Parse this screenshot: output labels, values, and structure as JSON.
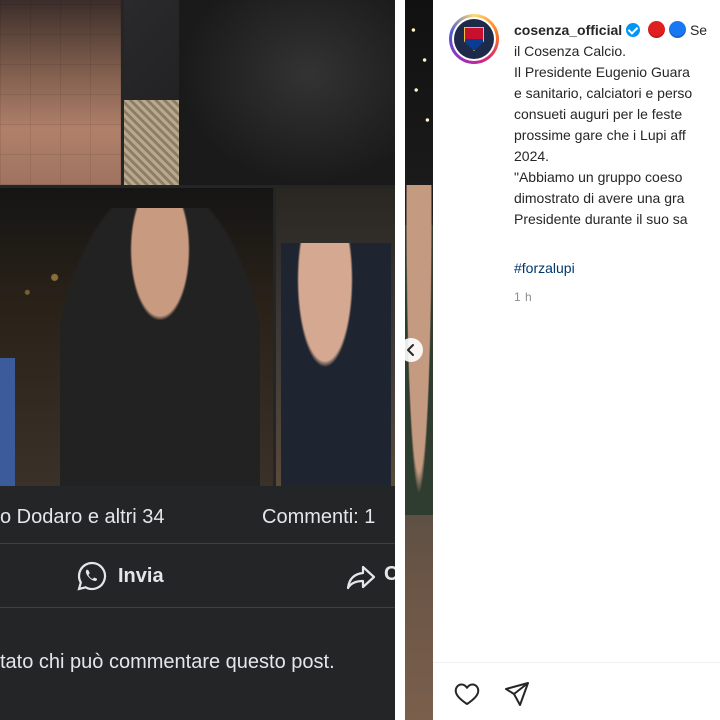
{
  "facebook_post": {
    "likes_text": "o Dodaro e altri 34",
    "comments_text": "Commenti: 1",
    "share_label": "Invia",
    "forward_label": "C",
    "restricted_text": "tato chi può commentare questo post."
  },
  "instagram_post": {
    "username": "cosenza_official",
    "caption_lines": [
      "Se",
      "il Cosenza Calcio.",
      "Il Presidente Eugenio Guara",
      "e sanitario, calciatori e perso",
      "consueti auguri per le feste",
      "prossime gare che i Lupi aff",
      "2024.",
      "\"Abbiamo un gruppo coeso",
      "dimostrato di avere una gra",
      "Presidente durante il suo sa"
    ],
    "hashtag": "#forzalupi",
    "time": "1 h",
    "icons": {
      "verified": "verified-badge-icon",
      "red_circle": "red-circle-emoji",
      "blue_circle": "blue-circle-emoji",
      "like": "heart-icon",
      "share": "paper-plane-icon",
      "carousel_prev": "chevron-left-icon"
    }
  },
  "colors": {
    "facebook_bg": "#242526",
    "facebook_text": "#e4e6eb",
    "instagram_link": "#00376b",
    "instagram_muted": "#8e8e8e",
    "verified": "#0095f6"
  }
}
